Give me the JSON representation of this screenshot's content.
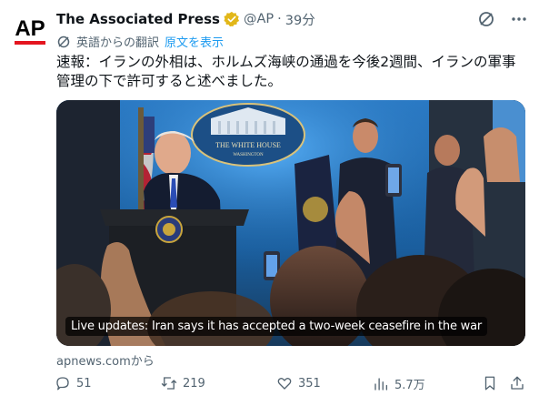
{
  "account": {
    "name": "The Associated Press",
    "handle": "@AP",
    "separator": "·",
    "time": "39分",
    "avatar_text": "AP"
  },
  "translation": {
    "label": "英語からの翻訳",
    "show_original": "原文を表示"
  },
  "tweet": {
    "text": "速報：イランの外相は、ホルムズ海峡の通過を今後2週間、イランの軍事管理の下で許可すると述べました。"
  },
  "card": {
    "caption": "Live updates: Iran says it has accepted a two-week ceasefire in the war",
    "seal_text": "THE WHITE HOUSE",
    "seal_subtext": "WASHINGTON"
  },
  "source": "apnews.comから",
  "actions": {
    "replies": "51",
    "reposts": "219",
    "likes": "351",
    "views": "5.7万"
  },
  "icons": {
    "grok": "grok-icon",
    "more": "more-icon",
    "translate": "translate-icon",
    "reply": "reply-icon",
    "repost": "repost-icon",
    "like": "like-icon",
    "views": "views-icon",
    "bookmark": "bookmark-icon",
    "share": "share-icon"
  },
  "colors": {
    "link": "#1d9bf0",
    "verified": "#e2b719",
    "ap_red": "#e4151f"
  }
}
